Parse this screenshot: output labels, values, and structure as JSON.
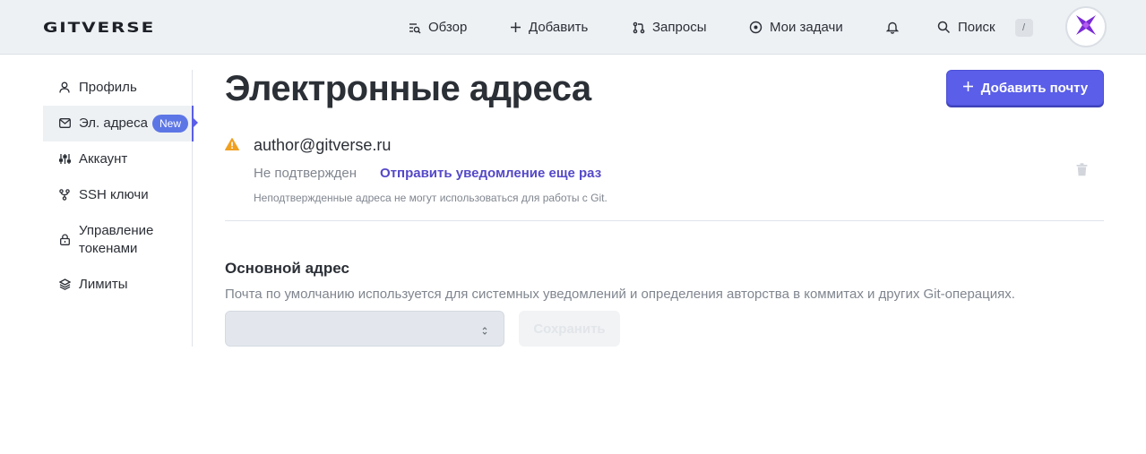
{
  "header": {
    "logo": "GITVERSE",
    "nav": [
      {
        "label": "Обзор",
        "icon": "overview-icon"
      },
      {
        "label": "Добавить",
        "icon": "plus-icon"
      },
      {
        "label": "Запросы",
        "icon": "pull-request-icon"
      },
      {
        "label": "Мои задачи",
        "icon": "issue-icon"
      }
    ],
    "notifications_icon": "bell-icon",
    "search": {
      "label": "Поиск",
      "shortcut": "/"
    },
    "avatar_icon": "avatar-logo-icon"
  },
  "sidebar": {
    "items": [
      {
        "label": "Профиль",
        "icon": "user-icon"
      },
      {
        "label": "Эл. адреса",
        "icon": "mail-icon",
        "badge": "New",
        "active": true
      },
      {
        "label": "Аккаунт",
        "icon": "sliders-icon"
      },
      {
        "label": "SSH ключи",
        "icon": "key-branch-icon"
      },
      {
        "label": "Управление токенами",
        "icon": "lock-icon"
      },
      {
        "label": "Лимиты",
        "icon": "layers-icon"
      }
    ]
  },
  "main": {
    "title": "Электронные адреса",
    "add_button": "Добавить почту",
    "email_entry": {
      "address": "author@gitverse.ru",
      "status": "Не подтвержден",
      "resend_link": "Отправить уведомление еще раз",
      "note": "Неподтвержденные адреса не могут использоваться для работы с Git.",
      "warning_icon": "warning-icon",
      "delete_icon": "trash-icon"
    },
    "primary": {
      "title": "Основной адрес",
      "description": "Почта по умолчанию используется для системных уведомлений и определения авторства в коммитах и других Git-операциях.",
      "select_value": "",
      "save_button": "Сохранить"
    }
  },
  "colors": {
    "accent": "#5a5ee8",
    "badge": "#5d76e6",
    "link": "#5448c8",
    "warning": "#f0a020",
    "header_bg": "#eef1f4"
  }
}
